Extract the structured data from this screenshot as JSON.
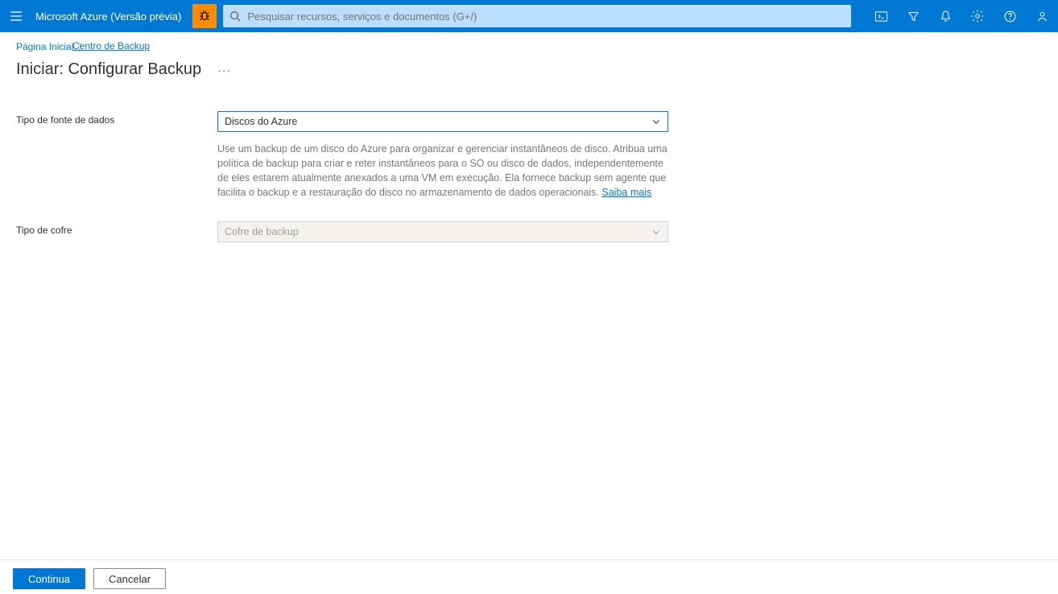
{
  "header": {
    "brand": "Microsoft Azure (Versão prévia)",
    "search_placeholder": "Pesquisar recursos, serviços e documentos (G+/)"
  },
  "breadcrumb": {
    "home": "Página Inicial",
    "overlap": "Centro de Backup"
  },
  "page": {
    "title": "Iniciar: Configurar Backup",
    "more": "···"
  },
  "form": {
    "datasource_label": "Tipo de fonte de dados",
    "datasource_value": "Discos do Azure",
    "description": "Use um backup de um disco do Azure para organizar e gerenciar instantâneos de disco. Atribua uma política de backup para criar e reter instantâneos para o SO ou disco de dados, independentemente de eles estarem atualmente anexados a uma VM em execução. Ela fornece backup sem agente que facilita o backup e a restauração do disco no armazenamento de dados operacionais. ",
    "learn_more": "Saiba mais",
    "vault_label": "Tipo de cofre",
    "vault_value": "Cofre de backup"
  },
  "footer": {
    "continue": "Continua",
    "cancel": "Cancelar"
  }
}
